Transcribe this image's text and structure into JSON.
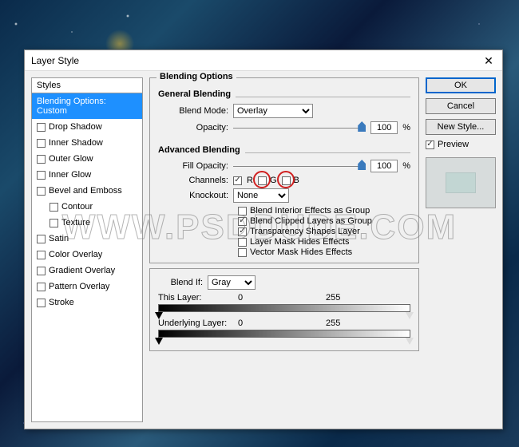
{
  "window": {
    "title": "Layer Style"
  },
  "styles_panel": {
    "header": "Styles",
    "items": [
      {
        "label": "Blending Options: Custom",
        "selected": true,
        "checkbox": false,
        "indent": 0
      },
      {
        "label": "Drop Shadow",
        "selected": false,
        "checkbox": true,
        "indent": 0
      },
      {
        "label": "Inner Shadow",
        "selected": false,
        "checkbox": true,
        "indent": 0
      },
      {
        "label": "Outer Glow",
        "selected": false,
        "checkbox": true,
        "indent": 0
      },
      {
        "label": "Inner Glow",
        "selected": false,
        "checkbox": true,
        "indent": 0
      },
      {
        "label": "Bevel and Emboss",
        "selected": false,
        "checkbox": true,
        "indent": 0
      },
      {
        "label": "Contour",
        "selected": false,
        "checkbox": true,
        "indent": 1
      },
      {
        "label": "Texture",
        "selected": false,
        "checkbox": true,
        "indent": 1
      },
      {
        "label": "Satin",
        "selected": false,
        "checkbox": true,
        "indent": 0
      },
      {
        "label": "Color Overlay",
        "selected": false,
        "checkbox": true,
        "indent": 0
      },
      {
        "label": "Gradient Overlay",
        "selected": false,
        "checkbox": true,
        "indent": 0
      },
      {
        "label": "Pattern Overlay",
        "selected": false,
        "checkbox": true,
        "indent": 0
      },
      {
        "label": "Stroke",
        "selected": false,
        "checkbox": true,
        "indent": 0
      }
    ]
  },
  "blending_options": {
    "title": "Blending Options",
    "general": {
      "title": "General Blending",
      "blend_mode_label": "Blend Mode:",
      "blend_mode_value": "Overlay",
      "opacity_label": "Opacity:",
      "opacity_value": "100",
      "opacity_unit": "%"
    },
    "advanced": {
      "title": "Advanced Blending",
      "fill_opacity_label": "Fill Opacity:",
      "fill_opacity_value": "100",
      "fill_opacity_unit": "%",
      "channels_label": "Channels:",
      "channel_r": "R",
      "channel_g": "G",
      "channel_b": "B",
      "knockout_label": "Knockout:",
      "knockout_value": "None",
      "opt1": "Blend Interior Effects as Group",
      "opt2": "Blend Clipped Layers as Group",
      "opt3": "Transparency Shapes Layer",
      "opt4": "Layer Mask Hides Effects",
      "opt5": "Vector Mask Hides Effects"
    },
    "blend_if": {
      "label": "Blend If:",
      "value": "Gray",
      "this_layer_label": "This Layer:",
      "this_low": "0",
      "this_high": "255",
      "under_label": "Underlying Layer:",
      "under_low": "0",
      "under_high": "255"
    }
  },
  "buttons": {
    "ok": "OK",
    "cancel": "Cancel",
    "new_style": "New Style...",
    "preview": "Preview"
  },
  "watermark": "WWW.PSDDUDE.COM"
}
